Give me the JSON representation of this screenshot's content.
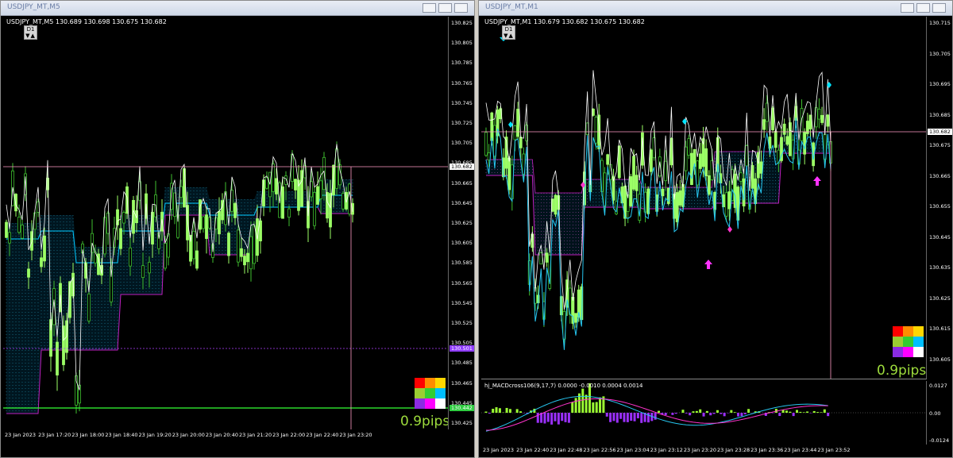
{
  "left_window": {
    "title": "USDJPY_MT,M5",
    "symbol_line": "USDJPY_MT,M5  130.689 130.698 130.675 130.682",
    "timeframe_badge": "D1",
    "pips": "0.9pips",
    "current_price": "130.682",
    "level_purple": "130.501",
    "level_green": "130.442",
    "price_labels": [
      "130.825",
      "130.805",
      "130.785",
      "130.765",
      "130.745",
      "130.725",
      "130.705",
      "130.685",
      "130.665",
      "130.645",
      "130.625",
      "130.605",
      "130.585",
      "130.565",
      "130.545",
      "130.525",
      "130.505",
      "130.485",
      "130.465",
      "130.445",
      "130.425"
    ],
    "time_labels": [
      "23 Jan 2023",
      "23 Jan 17:20",
      "23 Jan 18:00",
      "23 Jan 18:40",
      "23 Jan 19:20",
      "23 Jan 20:00",
      "23 Jan 20:40",
      "23 Jan 21:20",
      "23 Jan 22:00",
      "23 Jan 22:40",
      "23 Jan 23:20"
    ]
  },
  "right_window": {
    "title": "USDJPY_MT,M1",
    "symbol_line": "USDJPY_MT,M1  130.679 130.682 130.675 130.682",
    "timeframe_badge": "D1",
    "pips": "0.9pips",
    "current_price": "130.682",
    "price_labels": [
      "130.715",
      "130.705",
      "130.695",
      "130.685",
      "130.675",
      "130.665",
      "130.655",
      "130.645",
      "130.635",
      "130.625",
      "130.615",
      "130.605"
    ],
    "time_labels": [
      "23 Jan 2023",
      "23 Jan 22:40",
      "23 Jan 22:48",
      "23 Jan 22:56",
      "23 Jan 23:04",
      "23 Jan 23:12",
      "23 Jan 23:20",
      "23 Jan 23:28",
      "23 Jan 23:36",
      "23 Jan 23:44",
      "23 Jan 23:52"
    ],
    "macd_label": "hj_MACDcross106(9,17,7) 0.0000 -0.0010 0.0004 0.0014",
    "macd_levels": [
      "0.0127",
      "0.00",
      "-0.0124"
    ]
  },
  "palette_colors": [
    "#ff0000",
    "#ff8c00",
    "#ffd700",
    "#9acd32",
    "#32cd32",
    "#00bfff",
    "#8a2be2",
    "#ff00ff",
    "#ffffff"
  ],
  "colors": {
    "bull_candle": "#9cff66",
    "bear_candle": "#3fbf2f",
    "cloud": "#00c8ff",
    "cloud_edge": "#c020c0",
    "close_line": "#ffffff",
    "price_line": "#ff9bc6",
    "current_line": "#ffffff"
  }
}
